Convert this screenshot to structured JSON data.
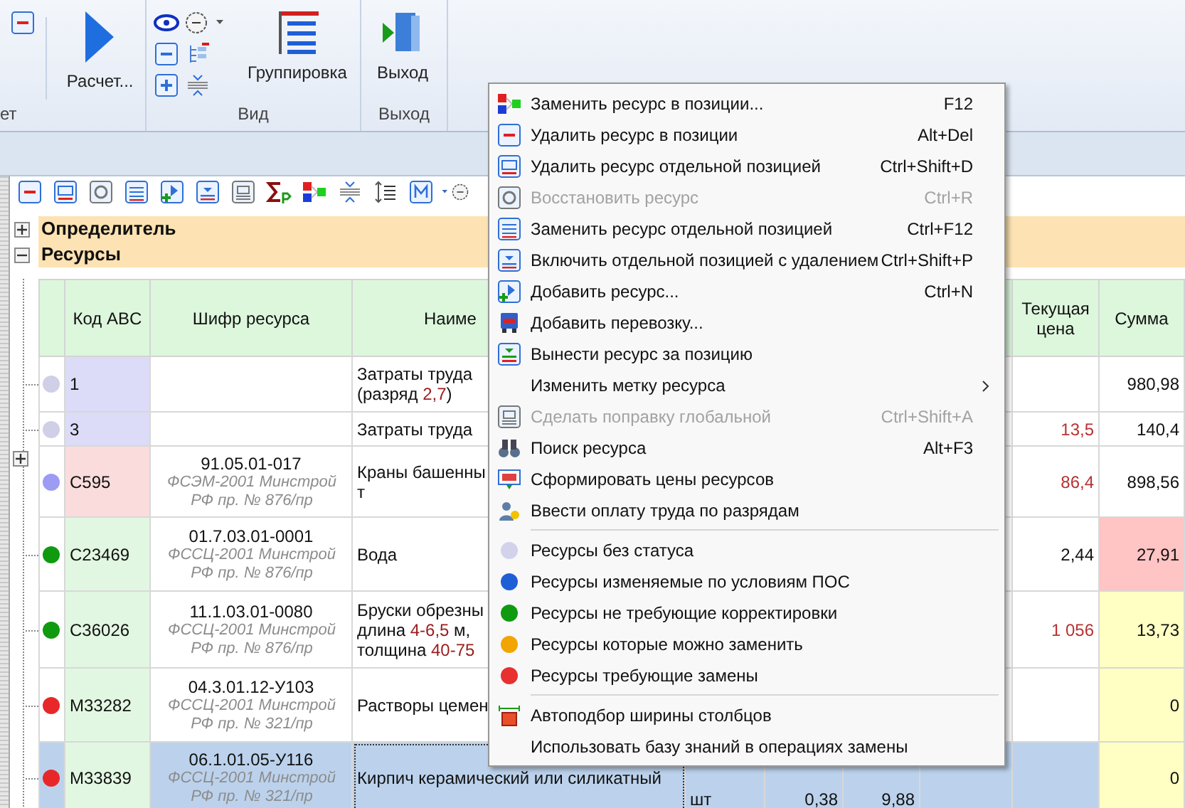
{
  "ribbon": {
    "groups": [
      {
        "label": "ет",
        "large_button": "Расчет..."
      },
      {
        "label": "Вид",
        "large_button": "Группировка"
      },
      {
        "label": "Выход",
        "large_button": "Выход"
      }
    ]
  },
  "tree": [
    {
      "label": "Определитель",
      "expanded": false
    },
    {
      "label": "Ресурсы",
      "expanded": true
    }
  ],
  "table": {
    "header": {
      "code": "Код ABC",
      "cipher": "Шифр ресурса",
      "name": "Наиме",
      "price": "Текущая цена",
      "sum": "Сумма"
    },
    "rows": [
      {
        "selected": false,
        "expandable": false,
        "status": {
          "color": "#cfcfe8"
        },
        "code": {
          "text": "1",
          "color": "#dcdcf8"
        },
        "name": [
          [
            {
              "text": "Затраты труда"
            }
          ],
          [
            {
              "text": "(разряд "
            },
            {
              "text": "2,7",
              "accent": true
            },
            {
              "text": ")"
            }
          ]
        ],
        "sum": {
          "text": "980,98"
        }
      },
      {
        "selected": false,
        "expandable": false,
        "status": {
          "color": "#cfcfe8"
        },
        "code": {
          "text": "3",
          "color": "#dcdcf8"
        },
        "name": [
          [
            {
              "text": "Затраты труда"
            }
          ]
        ],
        "price": {
          "text": "13,5",
          "changed": true
        },
        "sum": {
          "text": "140,4"
        }
      },
      {
        "selected": false,
        "expandable": true,
        "status": {
          "color": "#9c9cf4"
        },
        "code": {
          "text": "С595",
          "color": "#fadcdc"
        },
        "cipher": {
          "code": "91.05.01-017",
          "source": "ФСЭМ-2001 Минстрой РФ пр. № 876/пр"
        },
        "name": [
          [
            {
              "text": "Краны башенны"
            }
          ],
          [
            {
              "text": "т"
            }
          ]
        ],
        "price": {
          "text": "86,4",
          "changed": true
        },
        "sum": {
          "text": "898,56"
        }
      },
      {
        "selected": false,
        "expandable": false,
        "status": {
          "color": "#109a10"
        },
        "code": {
          "text": "С23469",
          "color": "#e2f7e2"
        },
        "cipher": {
          "code": "01.7.03.01-0001",
          "source": "ФССЦ-2001 Минстрой РФ пр. № 876/пр"
        },
        "name": [
          [
            {
              "text": "Вода"
            }
          ]
        ],
        "price": {
          "text": "2,44",
          "changed": false
        },
        "sum": {
          "text": "27,91",
          "color": "#ffc4c4"
        }
      },
      {
        "selected": false,
        "expandable": false,
        "status": {
          "color": "#109a10"
        },
        "code": {
          "text": "С36026",
          "color": "#e2f7e2"
        },
        "cipher": {
          "code": "11.1.03.01-0080",
          "source": "ФССЦ-2001 Минстрой РФ пр. № 876/пр"
        },
        "name": [
          [
            {
              "text": "Бруски обрезны"
            }
          ],
          [
            {
              "text": "длина "
            },
            {
              "text": "4-6,5",
              "accent": true
            },
            {
              "text": " м,"
            }
          ],
          [
            {
              "text": "толщина "
            },
            {
              "text": "40-75",
              "accent": true
            }
          ]
        ],
        "price": {
          "text": "1 056",
          "changed": true
        },
        "sum": {
          "text": "13,73",
          "color": "#ffffc4"
        }
      },
      {
        "selected": false,
        "expandable": false,
        "status": {
          "color": "#e82828"
        },
        "code": {
          "text": "М33282",
          "color": "#e2f7e2"
        },
        "cipher": {
          "code": "04.3.01.12-У103",
          "source": "ФССЦ-2001 Минстрой РФ пр. № 321/пр"
        },
        "name": [
          [
            {
              "text": "Растворы цемен"
            }
          ]
        ],
        "sum": {
          "text": "0",
          "color": "#ffffc4"
        }
      },
      {
        "selected": true,
        "expandable": false,
        "status": {
          "color": "#e82828"
        },
        "code": {
          "text": "М33839",
          "color": "#e2f7e2"
        },
        "cipher": {
          "code": "06.1.01.05-У116",
          "source": "ФССЦ-2001 Минстрой РФ пр. № 321/пр"
        },
        "name": [
          [
            {
              "text": "Кирпич керамический или силикатный"
            }
          ]
        ],
        "column_5": "шт",
        "column_6": "0,38",
        "column_7": "9,88",
        "sum": {
          "text": "0",
          "color": "#ffffc4"
        }
      }
    ]
  },
  "context_menu": [
    {
      "kind": "command",
      "label": "Заменить ресурс в позиции...",
      "shortcut": "F12",
      "disabled": false
    },
    {
      "kind": "command",
      "label": "Удалить ресурс в позиции",
      "shortcut": "Alt+Del",
      "disabled": false
    },
    {
      "kind": "command",
      "label": "Удалить ресурс отдельной позицией",
      "shortcut": "Ctrl+Shift+D",
      "disabled": false
    },
    {
      "kind": "command",
      "label": "Восстановить ресурс",
      "shortcut": "Ctrl+R",
      "disabled": true
    },
    {
      "kind": "command",
      "label": "Заменить ресурс отдельной позицией",
      "shortcut": "Ctrl+F12",
      "disabled": false
    },
    {
      "kind": "command",
      "label": "Включить отдельной позицией с удалением",
      "shortcut": "Ctrl+Shift+P",
      "disabled": false
    },
    {
      "kind": "command",
      "label": "Добавить ресурс...",
      "shortcut": "Ctrl+N",
      "disabled": false
    },
    {
      "kind": "command",
      "label": "Добавить перевозку...",
      "disabled": false
    },
    {
      "kind": "command",
      "label": "Вынести ресурс за позицию",
      "disabled": false
    },
    {
      "kind": "submenu",
      "label": "Изменить метку ресурса"
    },
    {
      "kind": "command",
      "label": "Сделать поправку глобальной",
      "shortcut": "Ctrl+Shift+A",
      "disabled": true
    },
    {
      "kind": "command",
      "label": "Поиск ресурса",
      "shortcut": "Alt+F3",
      "disabled": false
    },
    {
      "kind": "command",
      "label": "Сформировать цены ресурсов",
      "disabled": false
    },
    {
      "kind": "command",
      "label": "Ввести оплату труда по разрядам",
      "disabled": false
    },
    {
      "kind": "separator"
    },
    {
      "kind": "status",
      "label": "Ресурсы без статуса",
      "color": "#d2d2ea"
    },
    {
      "kind": "status",
      "label": "Ресурсы изменяемые по условиям ПОС",
      "color": "#1f5fd6"
    },
    {
      "kind": "status",
      "label": "Ресурсы не требующие корректировки",
      "color": "#109a10"
    },
    {
      "kind": "status",
      "label": "Ресурсы которые можно заменить",
      "color": "#f2a400"
    },
    {
      "kind": "status",
      "label": "Ресурсы требующие замены",
      "color": "#e83030"
    },
    {
      "kind": "separator"
    },
    {
      "kind": "command",
      "label": "Автоподбор ширины столбцов",
      "disabled": false
    },
    {
      "kind": "command",
      "label": "Использовать базу знаний в операциях замены",
      "disabled": false
    }
  ]
}
